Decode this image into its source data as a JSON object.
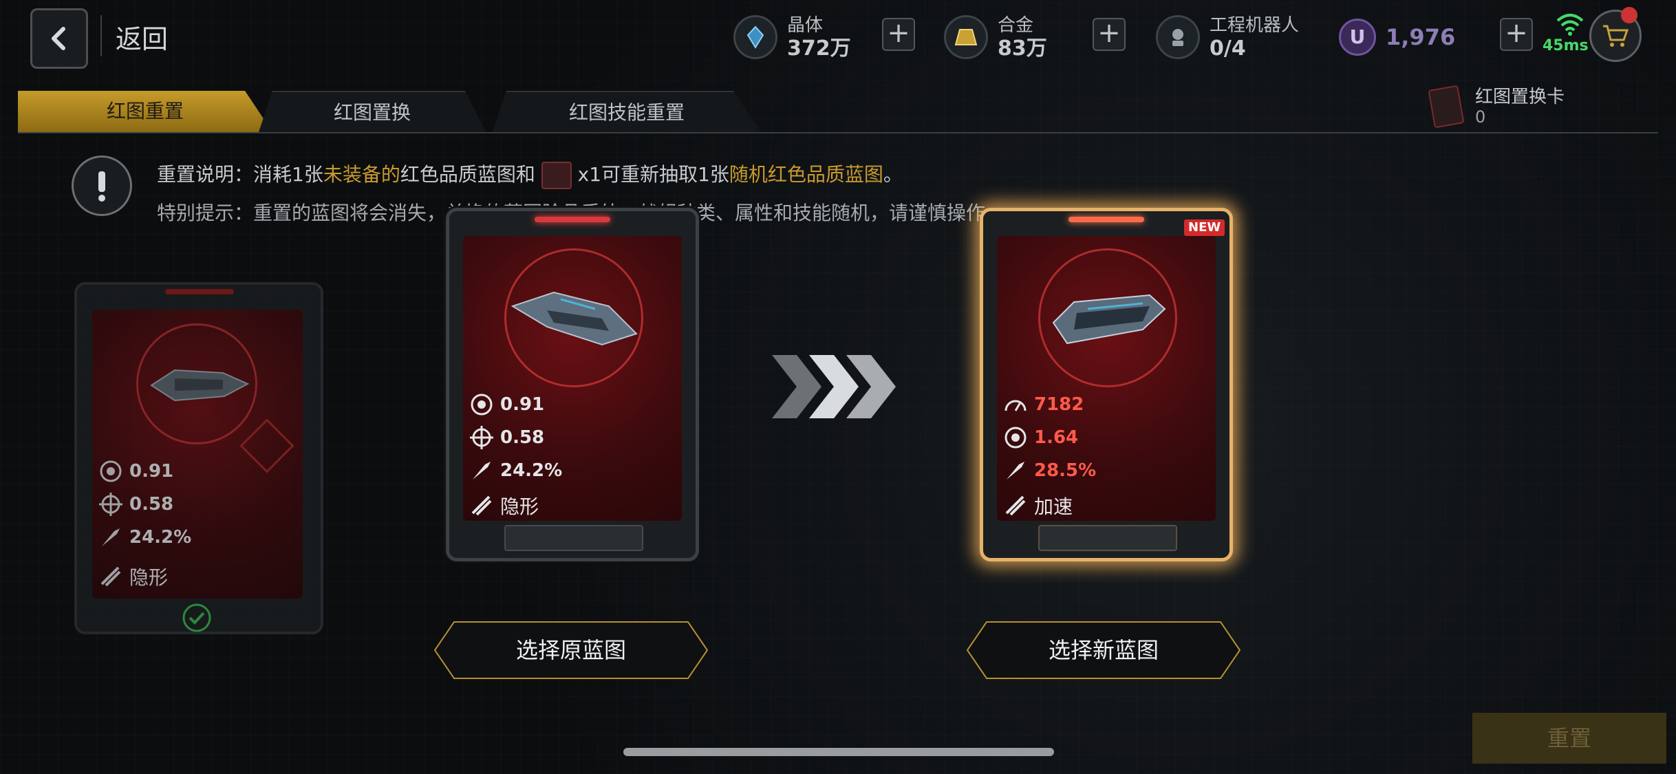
{
  "header": {
    "back_label": "返回",
    "resources": [
      {
        "icon": "crystal-icon",
        "name": "晶体",
        "value": "372万"
      },
      {
        "icon": "alloy-icon",
        "name": "合金",
        "value": "83万"
      },
      {
        "icon": "robot-icon",
        "name": "工程机器人",
        "value": "0/4"
      }
    ],
    "premium": {
      "icon": "u-currency-icon",
      "value": "1,976"
    },
    "ping": "45ms"
  },
  "tabs": [
    {
      "label": "红图重置",
      "active": true
    },
    {
      "label": "红图置换",
      "active": false
    },
    {
      "label": "红图技能重置",
      "active": false
    }
  ],
  "swap_card": {
    "name": "红图置换卡",
    "count": "0"
  },
  "info": {
    "line1_pre": "重置说明：消耗1张",
    "line1_hl1": "未装备的",
    "line1_mid": "红色品质蓝图和",
    "line1_mid2": "x1可重新抽取1张",
    "line1_hl2": "随机红色品质蓝图",
    "line1_end": "。",
    "line2": "特别提示：重置的蓝图将会消失，兑换的蓝图除品质外，战舰种类、属性和技能随机，请谨慎操作。"
  },
  "left_card": {
    "stats": [
      "0.91",
      "0.58",
      "24.2%"
    ],
    "skill": "隐形"
  },
  "original_card": {
    "stats": [
      "0.91",
      "0.58",
      "24.2%"
    ],
    "skill": "隐形"
  },
  "new_card": {
    "badge": "NEW",
    "stats": [
      "7182",
      "1.64",
      "28.5%"
    ],
    "skill": "加速"
  },
  "buttons": {
    "choose_original": "选择原蓝图",
    "choose_new": "选择新蓝图",
    "reset": "重置"
  },
  "colors": {
    "accent_gold": "#c69b2a",
    "stat_red": "#ff5a4a",
    "ping_green": "#47d86a",
    "new_glow": "#f4b35a"
  }
}
